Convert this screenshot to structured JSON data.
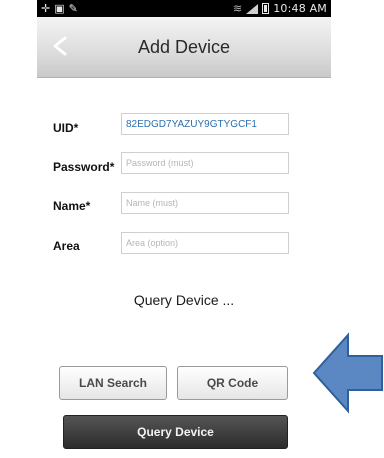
{
  "status_bar": {
    "time": "10:48 AM",
    "left_icons": [
      "usb-icon",
      "gallery-icon",
      "edit-icon"
    ],
    "right_icons": [
      "wifi-icon",
      "signal-icon",
      "battery-icon"
    ]
  },
  "header": {
    "back_icon": "chevron-left-icon",
    "title": "Add Device"
  },
  "form": {
    "uid_label": "UID*",
    "uid_value": "82EDGD7YAZUY9GTYGCF1",
    "password_label": "Password*",
    "password_placeholder": "Password (must)",
    "name_label": "Name*",
    "name_placeholder": "Name (must)",
    "area_label": "Area",
    "area_placeholder": "Area (option)"
  },
  "status_text": "Query Device ...",
  "buttons": {
    "lan_search": "LAN Search",
    "qr_code": "QR Code",
    "query_device": "Query Device"
  },
  "annotation": {
    "arrow_color": "#5b87c2",
    "arrow_icon": "left-arrow-icon"
  }
}
